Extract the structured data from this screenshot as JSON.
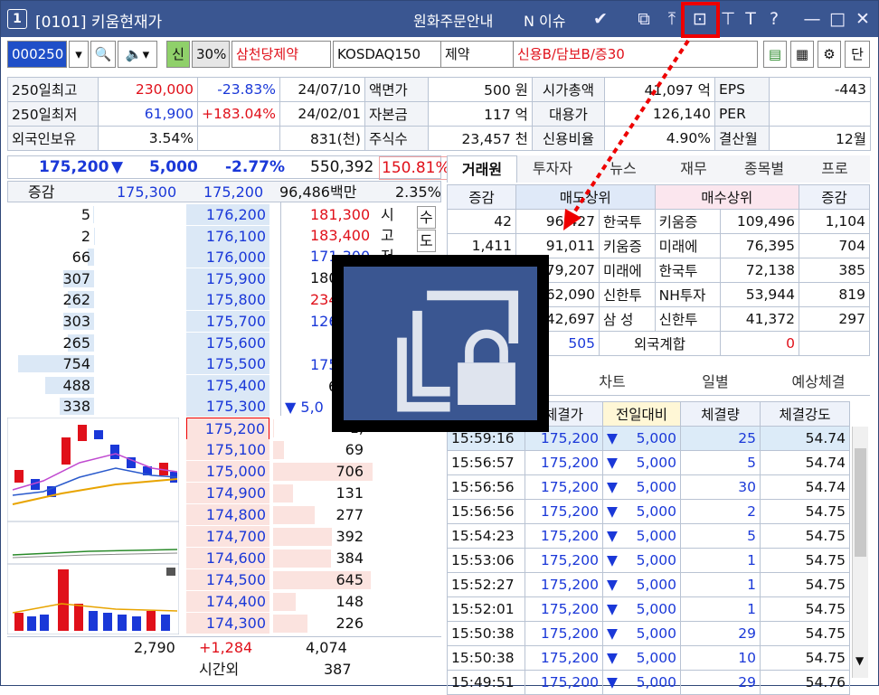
{
  "title": {
    "num": "1",
    "text": "[0101] 키움현재가",
    "guide": "원화주문안내",
    "issue": "N 이슈",
    "help": "?",
    "font_btn": "T"
  },
  "toolbar": {
    "code": "000250",
    "ratio": "30%",
    "shin": "신",
    "name": "삼천당제약",
    "market": "KOSDAQ150",
    "sector": "제약",
    "credit": "신용B/담보B/증30",
    "dan": "단"
  },
  "info": [
    [
      "250일최고",
      "230,000",
      "-23.83%",
      "24/07/10",
      "액면가",
      "500 원",
      "시가총액",
      "41,097 억",
      "EPS",
      "-443"
    ],
    [
      "250일최저",
      "61,900",
      "+183.04%",
      "24/02/01",
      "자본금",
      "117 억",
      "대용가",
      "126,140",
      "PER",
      ""
    ],
    [
      "외국인보유",
      "3.54%",
      "",
      "831(천)",
      "주식수",
      "23,457 천",
      "신용비율",
      "4.90%",
      "결산월",
      "12월"
    ]
  ],
  "quote": {
    "price": "175,200",
    "change": "5,000",
    "pct": "-2.77%",
    "volume": "550,392",
    "vol_ratio": "150.81%"
  },
  "ob_header": {
    "label": "증감",
    "v1": "175,300",
    "v2": "175,200",
    "amt": "96,486백만",
    "pct": "2.35%"
  },
  "asks": [
    {
      "q": "5",
      "p": "176,200"
    },
    {
      "q": "2",
      "p": "176,100"
    },
    {
      "q": "66",
      "p": "176,000"
    },
    {
      "q": "307",
      "p": "175,900"
    },
    {
      "q": "262",
      "p": "175,800"
    },
    {
      "q": "303",
      "p": "175,700"
    },
    {
      "q": "265",
      "p": "175,600"
    },
    {
      "q": "754",
      "p": "175,500"
    },
    {
      "q": "488",
      "p": "175,400"
    },
    {
      "q": "338",
      "p": "175,300"
    }
  ],
  "bids": [
    {
      "p": "175,200",
      "q": "1,"
    },
    {
      "p": "175,100",
      "q": "69"
    },
    {
      "p": "175,000",
      "q": "706"
    },
    {
      "p": "174,900",
      "q": "131"
    },
    {
      "p": "174,800",
      "q": "277"
    },
    {
      "p": "174,700",
      "q": "392"
    },
    {
      "p": "174,600",
      "q": "384"
    },
    {
      "p": "174,500",
      "q": "645"
    },
    {
      "p": "174,400",
      "q": "148"
    },
    {
      "p": "174,300",
      "q": "226"
    }
  ],
  "side": {
    "r1": "181,300",
    "l1": "시",
    "r2": "183,400",
    "l2": "고",
    "r3": "171,300",
    "l3": "저",
    "r4": "180",
    "r5": "234",
    "r6": "126",
    "r7": "175",
    "r8": "6",
    "r9": "▼ 5,0",
    "s1": "수",
    "s2": "도"
  },
  "ob_footer": {
    "ask_total": "2,790",
    "diff": "+1,284",
    "bid_total": "4,074",
    "after_label": "시간외",
    "after_val": "387"
  },
  "right_tabs": [
    "거래원",
    "투자자",
    "뉴스",
    "재무",
    "종목별",
    "프로"
  ],
  "broker_head": {
    "c1": "증감",
    "c2": "매도상위",
    "c3": "매수상위",
    "c4": "증감"
  },
  "brokers": [
    {
      "d1": "42",
      "sv": "96,427",
      "sn": "한국투",
      "bn": "키움증",
      "bv": "109,496",
      "d2": "1,104"
    },
    {
      "d1": "1,411",
      "sv": "91,011",
      "sn": "키움증",
      "bn": "미래에",
      "bv": "76,395",
      "d2": "704"
    },
    {
      "d1": "",
      "sv": "79,207",
      "sn": "미래에",
      "bn": "한국투",
      "bv": "72,138",
      "d2": "385"
    },
    {
      "d1": "",
      "sv": "62,090",
      "sn": "신한투",
      "bn": "NH투자",
      "bv": "53,944",
      "d2": "819"
    },
    {
      "d1": "",
      "sv": "42,697",
      "sn": "삼 성",
      "bn": "신한투",
      "bv": "41,372",
      "d2": "297"
    }
  ],
  "foreign": {
    "sv": "505",
    "label": "외국계합",
    "bv": "0"
  },
  "sub_tabs": [
    "차트",
    "일별",
    "예상체결"
  ],
  "trade_head": [
    "체결가",
    "전일대비",
    "체결량",
    "체결강도"
  ],
  "trades": [
    [
      "15:59:16",
      "175,200",
      "5,000",
      "25",
      "54.74"
    ],
    [
      "15:56:57",
      "175,200",
      "5,000",
      "5",
      "54.74"
    ],
    [
      "15:56:56",
      "175,200",
      "5,000",
      "30",
      "54.74"
    ],
    [
      "15:56:56",
      "175,200",
      "5,000",
      "2",
      "54.75"
    ],
    [
      "15:54:23",
      "175,200",
      "5,000",
      "5",
      "54.75"
    ],
    [
      "15:53:06",
      "175,200",
      "5,000",
      "1",
      "54.75"
    ],
    [
      "15:52:27",
      "175,200",
      "5,000",
      "1",
      "54.75"
    ],
    [
      "15:52:01",
      "175,200",
      "5,000",
      "1",
      "54.75"
    ],
    [
      "15:50:38",
      "175,200",
      "5,000",
      "29",
      "54.75"
    ],
    [
      "15:50:38",
      "175,200",
      "5,000",
      "10",
      "54.75"
    ],
    [
      "15:49:51",
      "175,200",
      "5,000",
      "29",
      "54.76"
    ]
  ],
  "colors": {
    "titlebar": "#3a5691",
    "up": "#e0101a",
    "down": "#1a38d8",
    "ask_bg": "#dbe8f6",
    "bid_bg": "#fbe3df"
  }
}
